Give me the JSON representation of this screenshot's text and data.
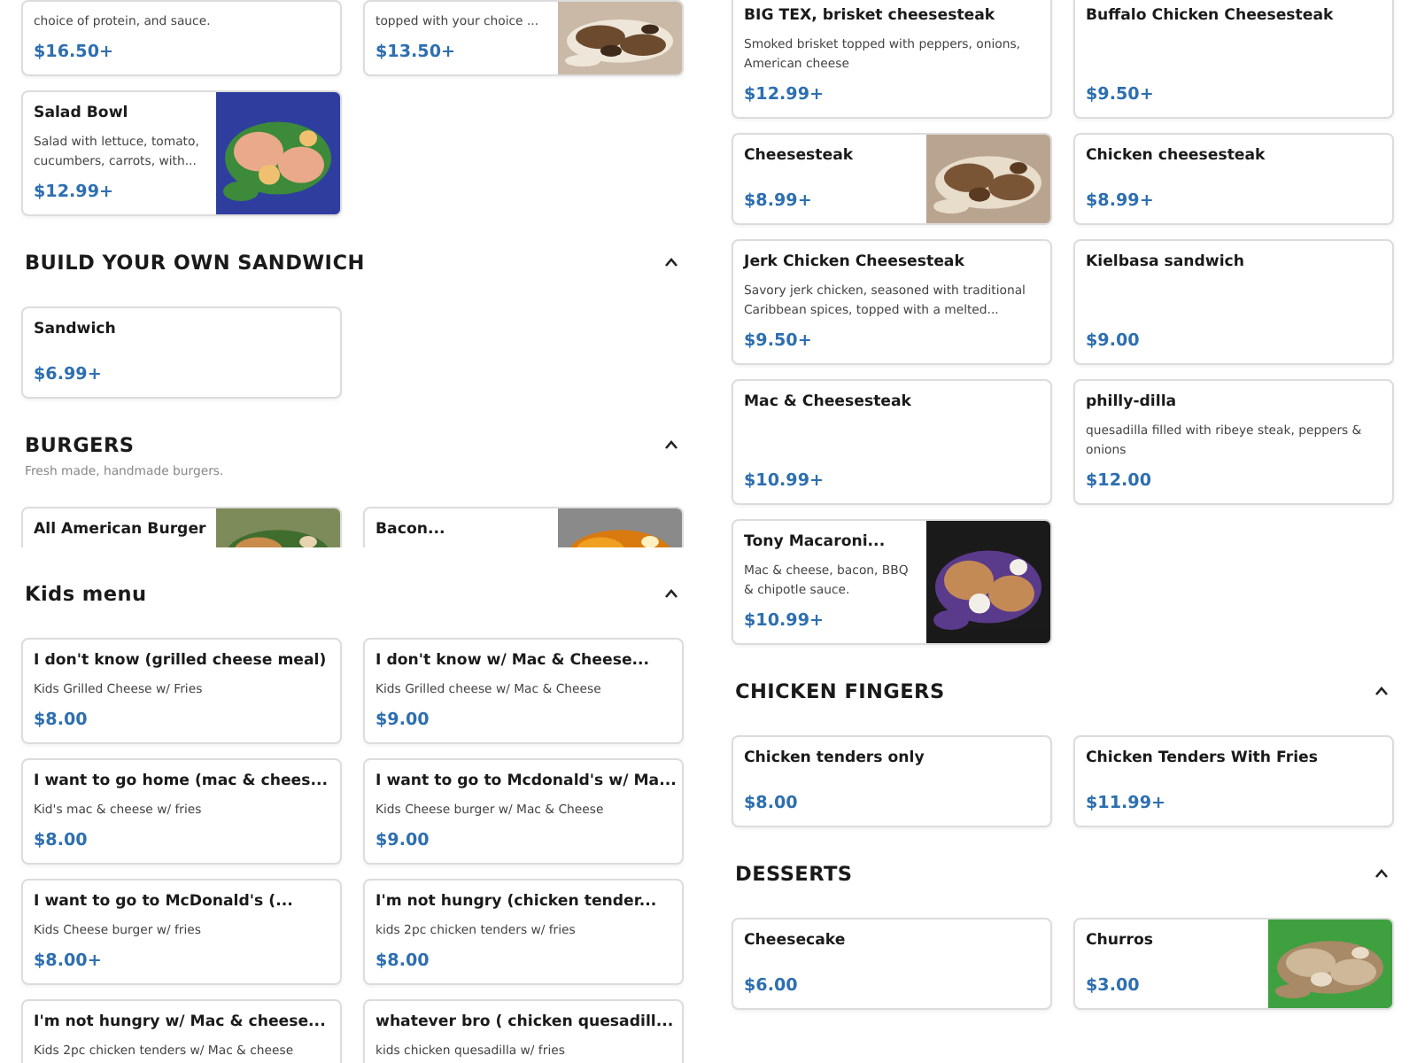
{
  "columns": [
    {
      "blocks": [
        {
          "kind": "cards",
          "cards": [
            {
              "kind": "plain",
              "description": "choice of protein, and sauce.",
              "price": "$16.50+"
            },
            {
              "kind": "picture",
              "description": "topped with your choice ...",
              "price": "$13.50+"
            },
            {
              "kind": "picture",
              "name": "Salad Bowl",
              "description": "Salad with lettuce, tomato, cucumbers, carrots, with...",
              "price": "$12.99+"
            }
          ]
        },
        {
          "kind": "section",
          "title": "BUILD YOUR OWN SANDWICH",
          "cards": [
            {
              "kind": "plain",
              "name": "Sandwich",
              "price": "$6.99+"
            }
          ]
        },
        {
          "kind": "section",
          "title": "BURGERS",
          "subtitle": "Fresh made, handmade burgers.",
          "clipped": true,
          "cards": [
            {
              "kind": "picture",
              "name": "All American Burger"
            },
            {
              "kind": "picture",
              "name": "Bacon..."
            }
          ]
        },
        {
          "kind": "section",
          "title": "Kids menu",
          "cards": [
            {
              "kind": "plain",
              "name": "I don't know (grilled cheese meal)",
              "description": "Kids Grilled Cheese w/ Fries",
              "price": "$8.00"
            },
            {
              "kind": "plain",
              "name": "I don't know w/ Mac & Cheese...",
              "description": "Kids Grilled cheese w/ Mac & Cheese",
              "price": "$9.00"
            },
            {
              "kind": "plain",
              "name": "I want to go home (mac & chees...",
              "description": "Kid's mac & cheese w/ fries",
              "price": "$8.00"
            },
            {
              "kind": "plain",
              "name": "I want to go to Mcdonald's w/ Ma...",
              "description": "Kids Cheese burger w/ Mac & Cheese",
              "price": "$9.00"
            },
            {
              "kind": "plain",
              "name": "I want to go to McDonald's (...",
              "description": "Kids Cheese burger w/ fries",
              "price": "$8.00+"
            },
            {
              "kind": "plain",
              "name": "I'm not hungry (chicken tender...",
              "description": "kids 2pc chicken tenders w/ fries",
              "price": "$8.00"
            },
            {
              "kind": "plain",
              "name": "I'm not hungry w/ Mac & cheese...",
              "description": "Kids 2pc chicken tenders w/ Mac & cheese"
            },
            {
              "kind": "plain",
              "name": "whatever bro ( chicken quesadill...",
              "description": "kids chicken quesadilla w/ fries"
            }
          ]
        }
      ]
    },
    {
      "blocks": [
        {
          "kind": "cards",
          "cards": [
            {
              "kind": "plain",
              "name": "BIG TEX, brisket cheesesteak",
              "description": "Smoked brisket topped with peppers, onions, American cheese",
              "price": "$12.99+"
            },
            {
              "kind": "plain",
              "name": "Buffalo Chicken Cheesesteak",
              "price": "$9.50+"
            },
            {
              "kind": "picture",
              "name": "Cheesesteak",
              "price": "$8.99+"
            },
            {
              "kind": "plain",
              "name": "Chicken cheesesteak",
              "price": "$8.99+"
            },
            {
              "kind": "plain",
              "name": "Jerk Chicken Cheesesteak",
              "description": "Savory jerk chicken, seasoned with traditional Caribbean spices, topped with a melted...",
              "price": "$9.50+"
            },
            {
              "kind": "plain",
              "name": "Kielbasa sandwich",
              "price": "$9.00"
            },
            {
              "kind": "plain",
              "name": "Mac & Cheesesteak",
              "price": "$10.99+"
            },
            {
              "kind": "plain",
              "name": "philly-dilla",
              "description": "quesadilla filled with ribeye steak, peppers & onions",
              "price": "$12.00"
            },
            {
              "kind": "picture",
              "name": "Tony Macaroni...",
              "description": "Mac & cheese, bacon, BBQ & chipotle sauce.",
              "price": "$10.99+"
            }
          ]
        },
        {
          "kind": "section",
          "title": "CHICKEN FINGERS",
          "cards": [
            {
              "kind": "plain",
              "name": "Chicken tenders only",
              "price": "$8.00"
            },
            {
              "kind": "plain",
              "name": "Chicken Tenders With Fries",
              "price": "$11.99+"
            }
          ]
        },
        {
          "kind": "section",
          "title": "DESSERTS",
          "cards": [
            {
              "kind": "plain",
              "name": "Cheesecake",
              "price": "$6.00"
            },
            {
              "kind": "picture",
              "name": "Churros",
              "price": "$3.00"
            }
          ]
        }
      ]
    }
  ]
}
